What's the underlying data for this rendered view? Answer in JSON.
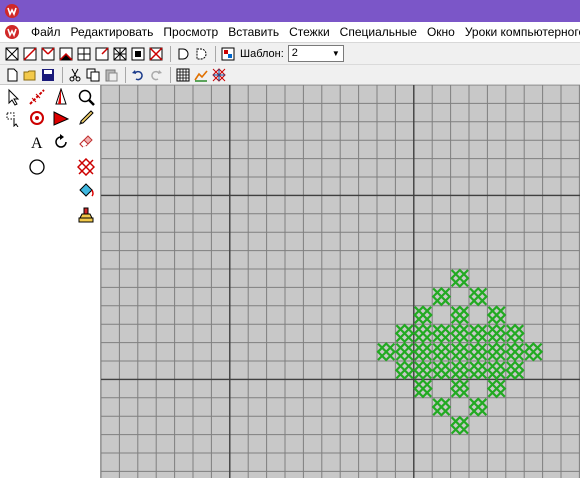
{
  "colors": {
    "titlebar": "#7b56c8",
    "grid_fill": "#c8c8c8",
    "grid_line": "#7f7f7f",
    "major_line": "#404040",
    "stitch": "#22aa22"
  },
  "menu": {
    "items": [
      "Файл",
      "Редактировать",
      "Просмотр",
      "Вставить",
      "Стежки",
      "Специальные",
      "Окно",
      "Уроки компьютерного"
    ]
  },
  "toolbar": {
    "template_label": "Шаблон:",
    "template_value": "2"
  },
  "toolbox": {
    "text_tool_glyph": "A"
  },
  "icons": [
    "app-logo-icon",
    "stitch-type-icon",
    "new-document-icon",
    "open-folder-icon",
    "save-icon",
    "cut-icon",
    "copy-icon",
    "paste-icon",
    "undo-icon",
    "redo-icon",
    "grid-icon",
    "chart-icon",
    "cross-stitch-icon",
    "arrow-select-icon",
    "stitch-line-icon",
    "fill-color-icon",
    "zoom-icon",
    "lasso-select-icon",
    "rotate-icon",
    "flip-icon",
    "pencil-icon",
    "text-tool-icon",
    "rotate-arrow-icon",
    "eraser-icon",
    "circle-tool-icon",
    "cross-stitch-tool-icon",
    "paint-bucket-icon",
    "stamp-icon"
  ]
}
